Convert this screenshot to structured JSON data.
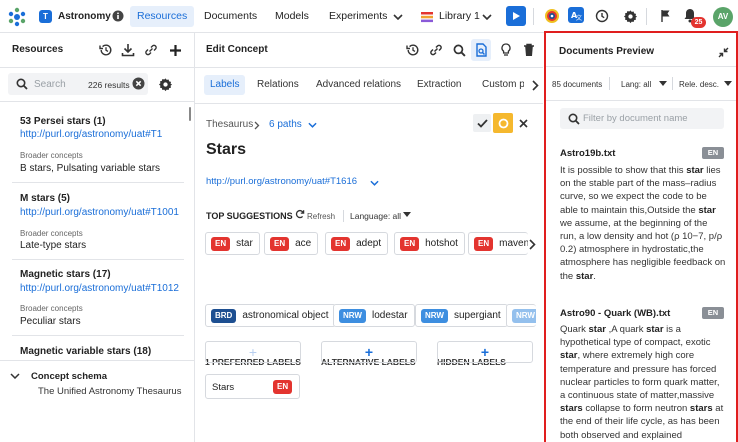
{
  "nav": {
    "app_name": "Astronomy",
    "app_badge": "T",
    "items": [
      "Resources",
      "Documents",
      "Models",
      "Experiments"
    ],
    "library_label": "Library 1",
    "notification_count": "25",
    "avatar_initials": "AV",
    "colors": {
      "accent": "#1a6ed8",
      "notification": "#e3342f",
      "avatar": "#5aa469"
    }
  },
  "resources": {
    "title": "Resources",
    "search_placeholder": "Search",
    "results_count": "226 results",
    "items": [
      {
        "term": "53 Persei stars (1)",
        "url": "http://purl.org/astronomy/uat#T1",
        "sub_label": "Broader concepts",
        "sub_value": "B stars, Pulsating variable stars"
      },
      {
        "term": "M stars (5)",
        "url": "http://purl.org/astronomy/uat#T1001",
        "sub_label": "Broader concepts",
        "sub_value": "Late-type stars"
      },
      {
        "term": "Magnetic stars (17)",
        "url": "http://purl.org/astronomy/uat#T1012",
        "sub_label": "Broader concepts",
        "sub_value": "Peculiar stars"
      },
      {
        "term": "Magnetic variable stars (18)"
      }
    ],
    "schema_title": "Concept schema",
    "schema_item": "The Unified Astronomy Thesaurus"
  },
  "editor": {
    "title": "Edit Concept",
    "tabs": [
      "Labels",
      "Relations",
      "Advanced relations",
      "Extraction",
      "Custom pro"
    ],
    "breadcrumb_root": "Thesaurus",
    "breadcrumb_paths": "6 paths",
    "concept_title": "Stars",
    "concept_url": "http://purl.org/astronomy/uat#T1616",
    "suggestions_title": "TOP SUGGESTIONS",
    "refresh_label": "Refresh",
    "language_filter": "Language: all",
    "suggestions_row1": [
      {
        "lang": "EN",
        "label": "star"
      },
      {
        "lang": "EN",
        "label": "ace"
      },
      {
        "lang": "EN",
        "label": "adept"
      },
      {
        "lang": "EN",
        "label": "hotshot"
      },
      {
        "lang": "EN",
        "label": "maven"
      }
    ],
    "suggestions_row2": [
      {
        "lang": "BRD",
        "label": "astronomical object"
      },
      {
        "lang": "NRW",
        "label": "lodestar"
      },
      {
        "lang": "NRW",
        "label": "supergiant"
      },
      {
        "lang": "NRW",
        "label": ""
      }
    ],
    "preferred_header": "1 PREFERRED LABELS",
    "alternative_header": "ALTERNATIVE LABELS",
    "hidden_header": "HIDDEN LABELS",
    "preferred_label": {
      "text": "Stars",
      "lang": "EN"
    }
  },
  "preview": {
    "title": "Documents Preview",
    "doc_count": "85 documents",
    "lang_filter": "Lang: all",
    "sort": "Rele. desc.",
    "filter_placeholder": "Filter by document name",
    "docs": [
      {
        "name": "Astro19b.txt",
        "lang": "EN"
      },
      {
        "name": "Astro90 - Quark (WB).txt",
        "lang": "EN"
      }
    ],
    "doc1_text": [
      "It is possible to show that this ",
      "star",
      " lies on the stable part of the mass–radius curve, so we expect the code to be able to maintain this,Outside the ",
      "star",
      " we assume, at the beginning of the run, a low density and hot (ρ 10−7, p/ρ 0.2) atmosphere in hydrostatic,the atmosphere has negligible feedback on the ",
      "star",
      "."
    ],
    "doc2_text": [
      "Quark ",
      "star",
      " ,A quark ",
      "star",
      " is a hypothetical type of compact, exotic ",
      "star",
      ", where extremely high core temperature and pressure has forced nuclear particles to form quark matter, a continuous state of matter,massive ",
      "stars",
      " collapse to form neutron ",
      "stars",
      " at the end of their life cycle, as has been both observed and explained"
    ]
  }
}
